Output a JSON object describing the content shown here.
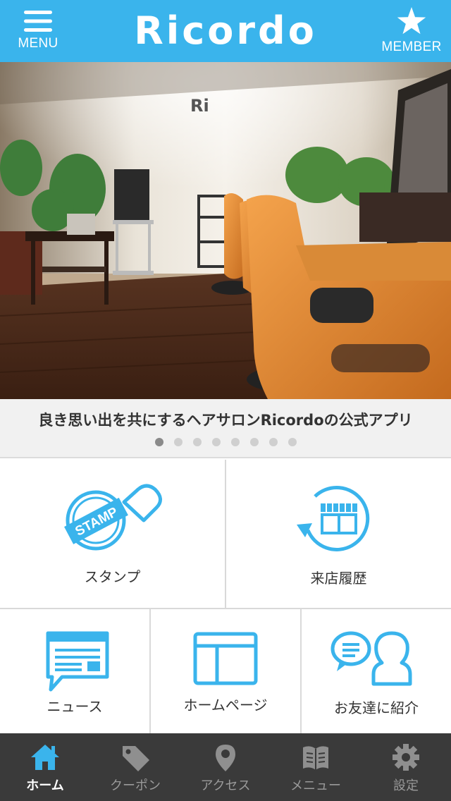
{
  "header": {
    "title": "Ricordo",
    "menu_label": "MENU",
    "member_label": "MEMBER",
    "menu_icon": "hamburger-icon",
    "member_icon": "star-icon"
  },
  "hero": {
    "image": "salon-interior-photo",
    "sign_text": "Ri"
  },
  "carousel": {
    "caption": "良き思い出を共にするヘアサロンRicordoの公式アプリ",
    "page_count": 8,
    "active_index": 0
  },
  "grid": {
    "stamp": {
      "label": "スタンプ",
      "icon": "stamp-icon",
      "icon_text": "STAMP"
    },
    "history": {
      "label": "来店履歴",
      "icon": "shop-history-icon"
    },
    "news": {
      "label": "ニュース",
      "icon": "news-icon"
    },
    "homepage": {
      "label": "ホームページ",
      "icon": "browser-icon"
    },
    "invite": {
      "label": "お友達に紹介",
      "icon": "friends-chat-icon"
    }
  },
  "tabbar": {
    "items": [
      {
        "label": "ホーム",
        "icon": "home-icon",
        "active": true
      },
      {
        "label": "クーポン",
        "icon": "tag-icon",
        "active": false
      },
      {
        "label": "アクセス",
        "icon": "map-pin-icon",
        "active": false
      },
      {
        "label": "メニュー",
        "icon": "book-icon",
        "active": false
      },
      {
        "label": "設定",
        "icon": "gear-icon",
        "active": false
      }
    ]
  },
  "colors": {
    "accent": "#3ab4ec",
    "tabbar_bg": "#3a3a3a",
    "tab_active": "#ffffff",
    "tab_inactive": "#9a9a9a"
  }
}
